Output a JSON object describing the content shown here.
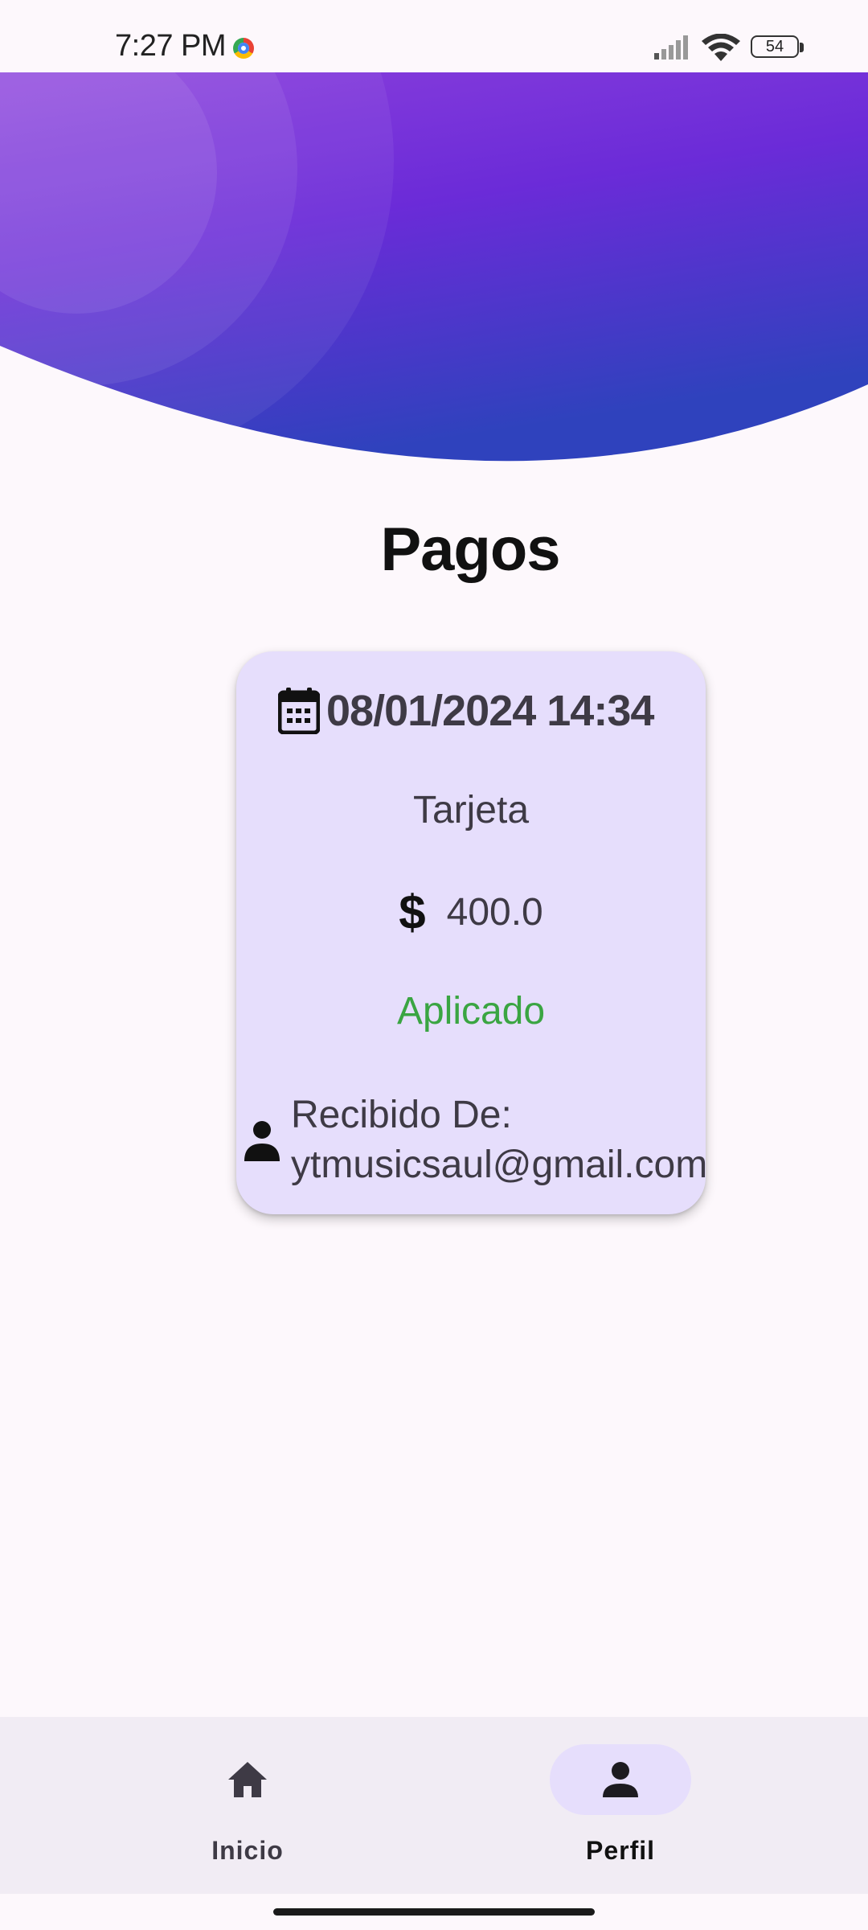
{
  "status_bar": {
    "time": "7:27 PM",
    "battery": "54"
  },
  "page": {
    "title": "Pagos"
  },
  "payment": {
    "date": "08/01/2024 14:34",
    "method": "Tarjeta",
    "currency_symbol": "$",
    "amount": "400.0",
    "status": "Aplicado",
    "received_label": "Recibido De:",
    "received_email": "ytmusicsaul@gmail.com"
  },
  "icons": {
    "date": "calendar-icon",
    "amount": "dollar-icon",
    "received": "person-icon",
    "home": "home-icon",
    "profile": "person-icon"
  },
  "colors": {
    "header_gradient_start": "#8a3fdc",
    "header_gradient_end": "#3341c0",
    "card_background": "#e6defc",
    "status_applied": "#3aa542",
    "nav_background": "#f1ecf4"
  },
  "bottom_nav": {
    "items": [
      {
        "label": "Inicio",
        "icon": "home-icon",
        "active": false
      },
      {
        "label": "Perfil",
        "icon": "person-icon",
        "active": true
      }
    ]
  }
}
